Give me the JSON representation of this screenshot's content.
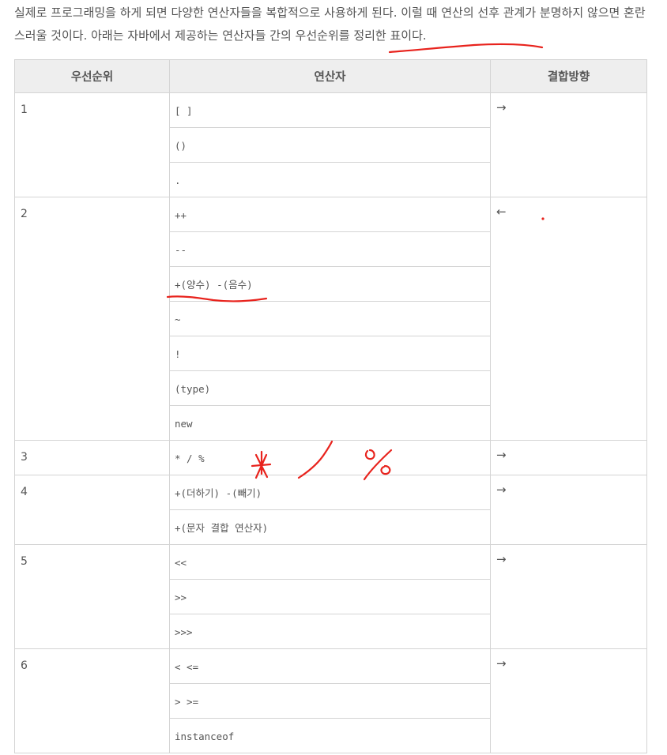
{
  "intro": {
    "text": "실제로 프로그래밍을 하게 되면 다양한 연산자들을 복합적으로 사용하게 된다. 이럴 때 연산의 선후 관계가 분명하지 않으면 혼란스러울 것이다. 아래는 자바에서 제공하는 연산자들 간의 우선순위를 정리한 표이다."
  },
  "table": {
    "headers": [
      "우선순위",
      "연산자",
      "결합방향"
    ],
    "rows": [
      {
        "rank": "1",
        "direction": "→",
        "operators": [
          "[ ]",
          "()",
          "."
        ]
      },
      {
        "rank": "2",
        "direction": "←",
        "operators": [
          "++",
          "--",
          "+(양수) -(음수)",
          "~",
          "!",
          "(type)",
          "new"
        ]
      },
      {
        "rank": "3",
        "direction": "→",
        "operators": [
          "* / %"
        ]
      },
      {
        "rank": "4",
        "direction": "→",
        "operators": [
          "+(더하기) -(빼기)",
          "+(문자 결합 연산자)"
        ]
      },
      {
        "rank": "5",
        "direction": "→",
        "operators": [
          "<<",
          ">>",
          ">>>"
        ]
      },
      {
        "rank": "6",
        "direction": "→",
        "operators": [
          "< <=",
          "> >=",
          "instanceof"
        ]
      }
    ]
  },
  "annotations": {
    "ink_color": "#e8231d",
    "handwriting": [
      "*",
      "/",
      "%"
    ]
  }
}
